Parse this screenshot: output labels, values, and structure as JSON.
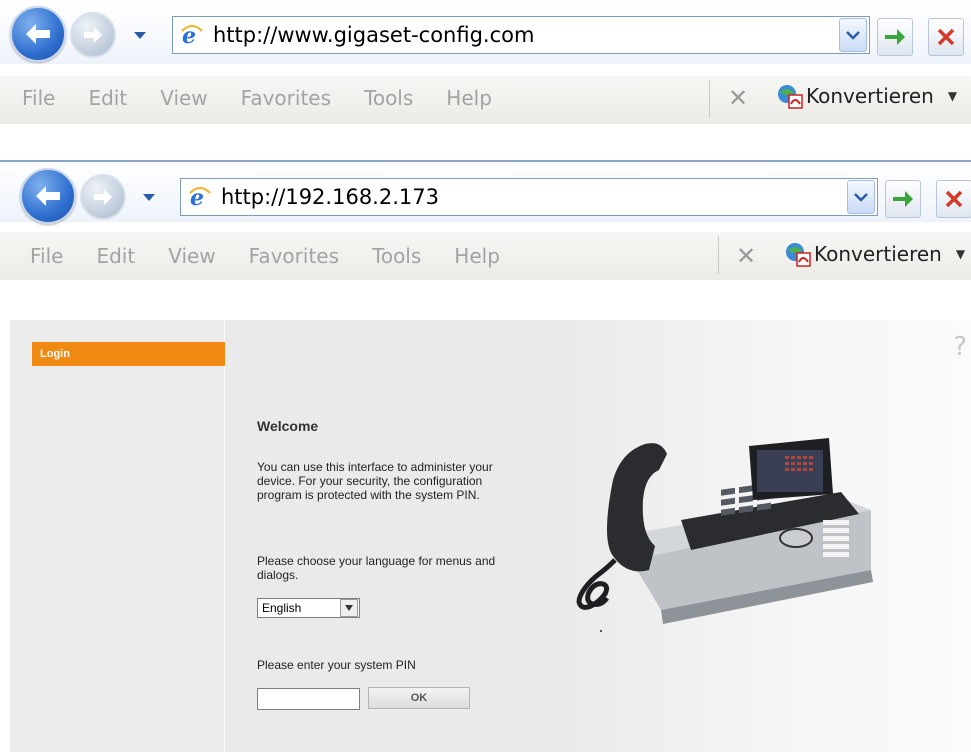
{
  "browser1": {
    "url": "http://www.gigaset-config.com",
    "menu": [
      "File",
      "Edit",
      "View",
      "Favorites",
      "Tools",
      "Help"
    ],
    "konvertieren_label": "Konvertieren"
  },
  "browser2": {
    "url": "http://192.168.2.173",
    "menu": [
      "File",
      "Edit",
      "View",
      "Favorites",
      "Tools",
      "Help"
    ],
    "konvertieren_label": "Konvertieren"
  },
  "page": {
    "sidebar_login": "Login",
    "help_icon": "?",
    "welcome_title": "Welcome",
    "intro_text": "You can use this interface to administer your device. For your security, the configuration program is protected with the system PIN.",
    "language_prompt": "Please choose your language for menus and dialogs.",
    "language_selected": "English",
    "pin_prompt": "Please enter your system PIN",
    "pin_value": "",
    "ok_label": "OK"
  },
  "colors": {
    "accent_orange": "#f08a12",
    "go_green": "#3aa63a",
    "stop_red": "#d33a2a"
  },
  "icons": [
    "back-icon",
    "forward-icon",
    "ie-icon",
    "dropdown-icon",
    "go-arrow-icon",
    "stop-icon",
    "close-icon",
    "konvertieren-icon",
    "help-icon",
    "phone-image"
  ]
}
